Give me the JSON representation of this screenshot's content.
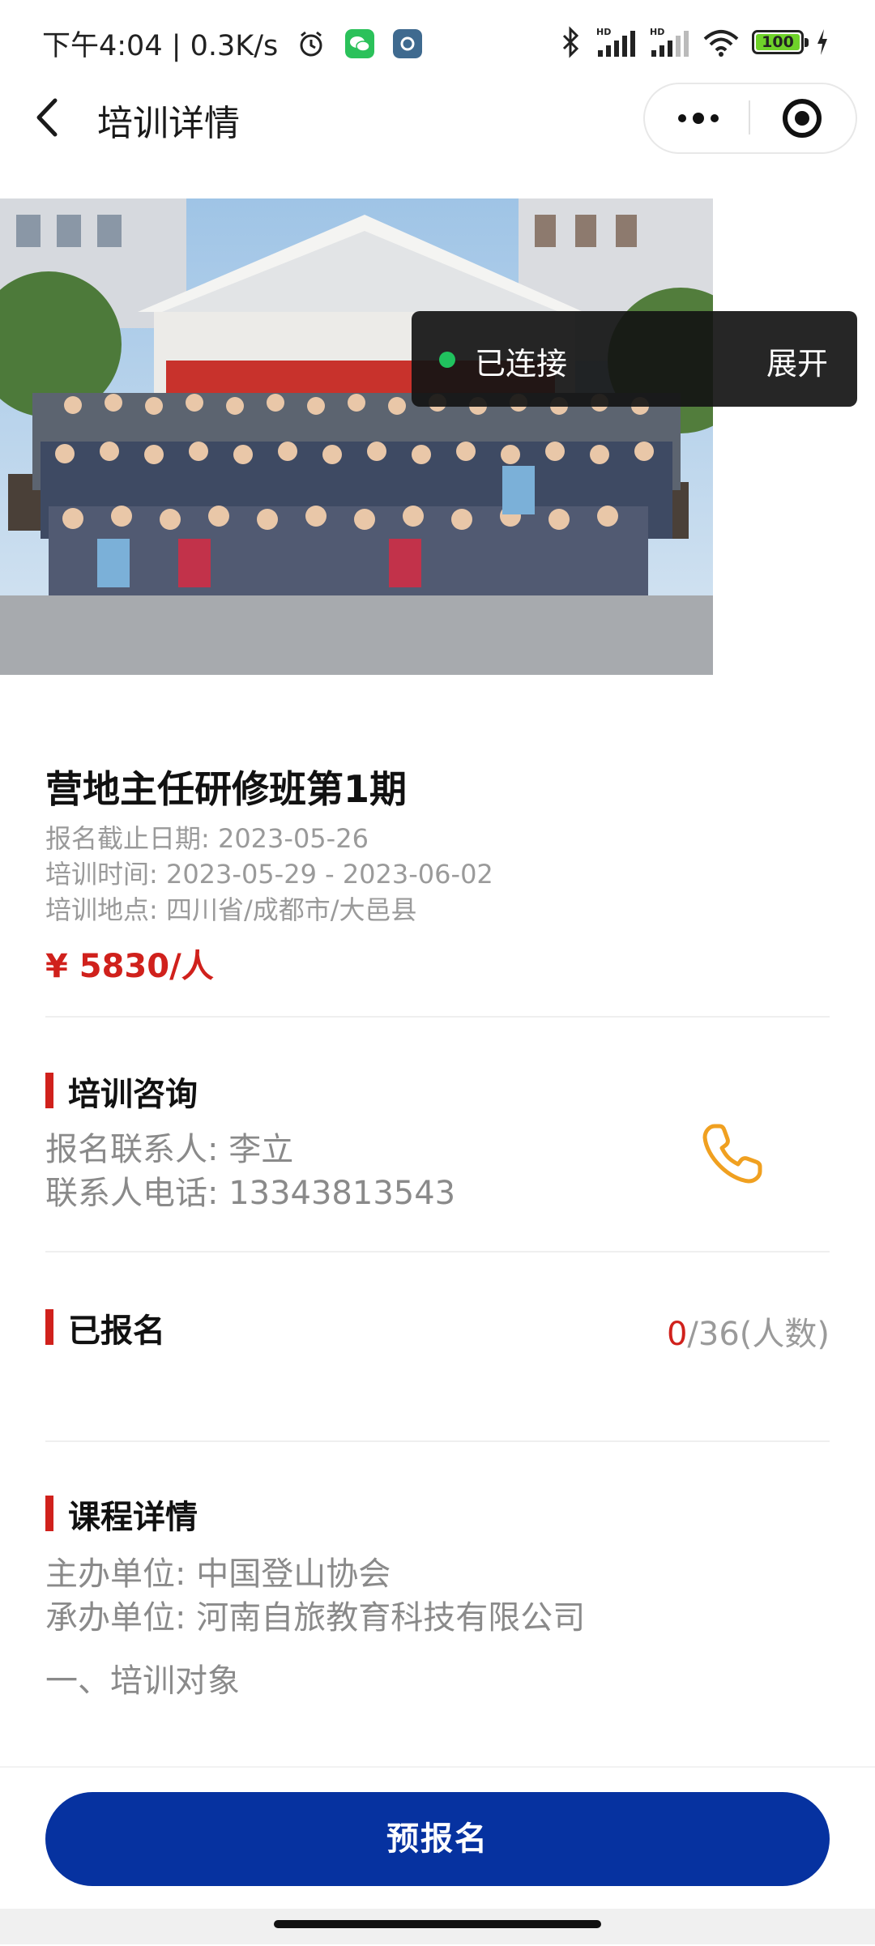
{
  "status_bar": {
    "time_speed": "下午4:04 | 0.3K/s",
    "battery": "100"
  },
  "nav": {
    "title": "培训详情"
  },
  "overlay": {
    "status": "已连接",
    "expand": "展开"
  },
  "course": {
    "title": "营地主任研修班第1期",
    "deadline": "报名截止日期: 2023-05-26",
    "time": "培训时间: 2023-05-29 - 2023-06-02",
    "location": "培训地点: 四川省/成都市/大邑县",
    "price": "¥ 5830/人"
  },
  "consult": {
    "title": "培训咨询",
    "contact": "报名联系人: 李立",
    "phone": "联系人电话: 13343813543"
  },
  "enrolled": {
    "title": "已报名",
    "count": "0",
    "capacity": "/36(人数)"
  },
  "details": {
    "title": "课程详情",
    "host": "主办单位: 中国登山协会",
    "organizer": "承办单位: 河南自旅教育科技有限公司",
    "section1": "一、培训对象"
  },
  "cta": {
    "label": "预报名"
  },
  "colors": {
    "accent_red": "#d0211c",
    "cta_blue": "#0632a0",
    "connected_green": "#20c25e",
    "phone_icon": "#f0a020"
  }
}
